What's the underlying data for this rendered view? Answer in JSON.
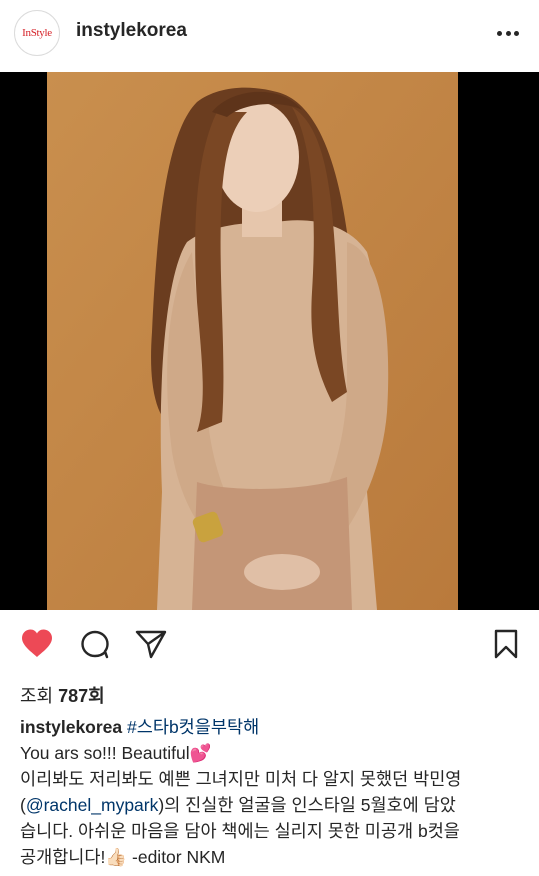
{
  "post": {
    "username": "instylekorea",
    "avatar_text": "InStyle",
    "views_label": "조회",
    "views_count": "787회",
    "caption": {
      "username": "instylekorea",
      "hashtag": "#스타b컷을부탁해",
      "line1": "You ars so!!! Beautiful💕",
      "line2": "이리봐도 저리봐도 예쁜 그녀지만 미처 다 알지 못했던 박민영",
      "line3_open": "(",
      "line3_mention": "@rachel_mypark",
      "line3_rest": ")의 진실한 얼굴을 인스타일 5월호에 담았",
      "line4": "습니다. 아쉬운 마음을 담아 책에는 실리지 못한 미공개 b컷을",
      "line5": "공개합니다!👍🏻 -editor NKM"
    }
  },
  "icons": {
    "more": "more-options-icon",
    "like": "heart-icon",
    "comment": "comment-icon",
    "share": "share-icon",
    "save": "bookmark-icon"
  },
  "colors": {
    "like_red": "#ed4956",
    "link_blue": "#003569",
    "photo_background": "#c58a49"
  }
}
